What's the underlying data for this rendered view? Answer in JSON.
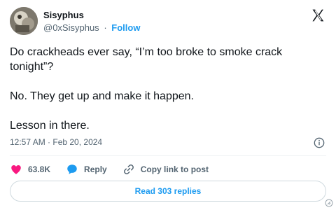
{
  "author": {
    "name": "Sisyphus",
    "handle": "@0xSisyphus",
    "separator": "·",
    "follow_label": "Follow"
  },
  "tweet": {
    "paragraphs": [
      "Do crackheads ever say, “I’m too broke to smoke crack tonight”?",
      "No. They get up and make it happen.",
      "Lesson in there."
    ],
    "timestamp": "12:57 AM · Feb 20, 2024"
  },
  "actions": {
    "likes_count": "63.8K",
    "reply_label": "Reply",
    "copy_link_label": "Copy link to post"
  },
  "read_replies_label": "Read 303 replies",
  "colors": {
    "accent": "#1d9bf0",
    "like": "#f91880",
    "text_primary": "#0f1419",
    "text_secondary": "#536471",
    "border": "#cfd9de"
  },
  "icons": {
    "logo": "x-logo-icon",
    "info": "info-icon",
    "like": "heart-icon",
    "reply": "speech-bubble-icon",
    "copy_link": "link-icon"
  }
}
